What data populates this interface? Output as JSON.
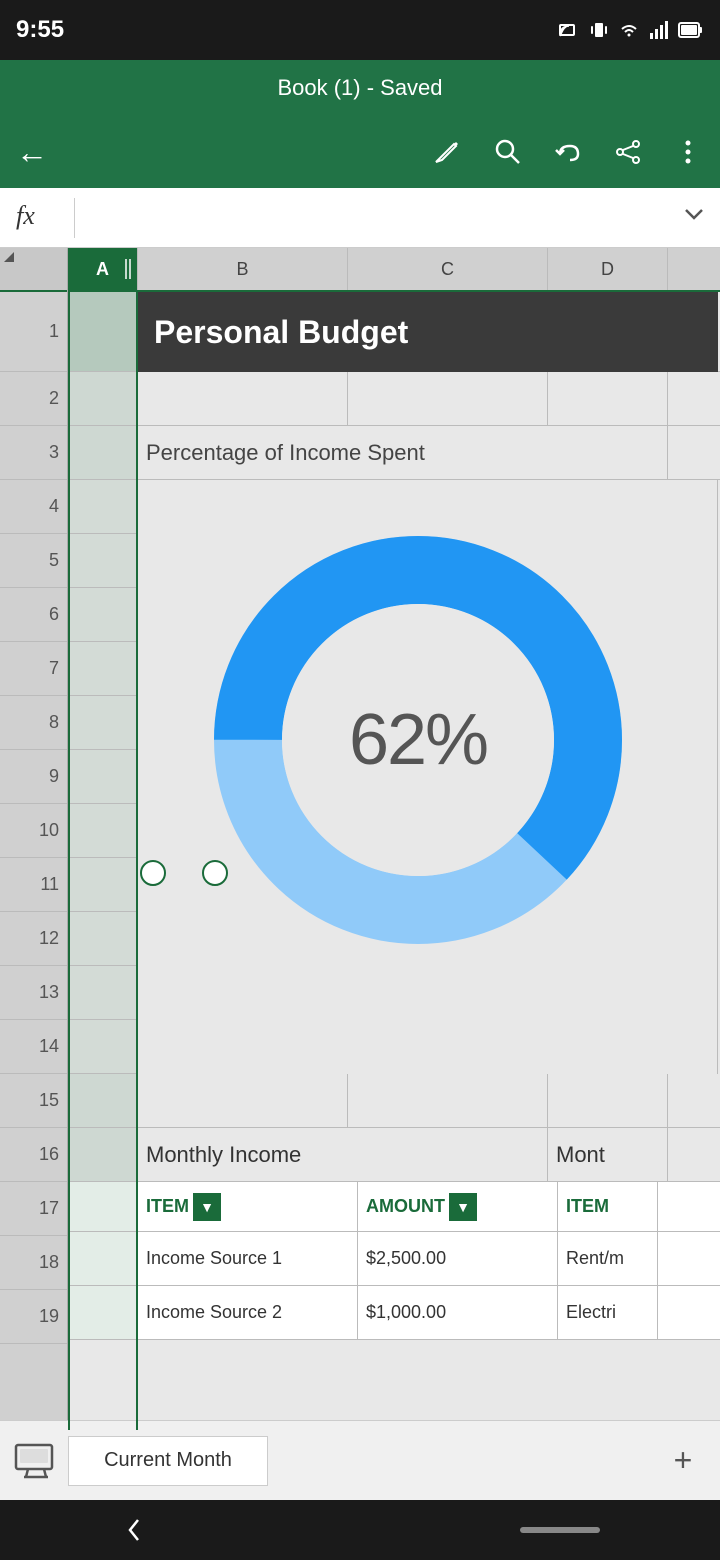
{
  "statusBar": {
    "time": "9:55",
    "icons": [
      "signal",
      "circle",
      "gmail",
      "calendar",
      "dot",
      "cast",
      "vibrate",
      "wifi",
      "signal-bars",
      "battery"
    ]
  },
  "titleBar": {
    "title": "Book (1) - Saved"
  },
  "toolbar": {
    "backLabel": "←",
    "editIcon": "✏",
    "searchIcon": "⌕",
    "undoIcon": "↩",
    "shareIcon": "⤴",
    "moreIcon": "⋮"
  },
  "formulaBar": {
    "fx": "fx",
    "expandIcon": "∨"
  },
  "spreadsheet": {
    "colHeaders": [
      "A",
      "B",
      "C",
      "D"
    ],
    "rowNumbers": [
      "",
      "1",
      "2",
      "3",
      "4",
      "5",
      "6",
      "7",
      "8",
      "9",
      "10",
      "11",
      "12",
      "13",
      "14",
      "15",
      "16",
      "17",
      "18",
      "19"
    ],
    "personalBudget": "Personal Budget",
    "percentageLabel": "Percentage of Income Spent",
    "donutPercent": "62%",
    "monthlyIncomeLabel": "Monthly Income",
    "monthlyExpenseLabel": "Mont",
    "itemHeader": "ITEM",
    "amountHeader": "AMOUNT",
    "expenseItemHeader": "ITEM",
    "incomeRow1Item": "Income Source 1",
    "incomeRow1Amount": "$2,500.00",
    "incomeRow2Item": "Income Source 2",
    "incomeRow2Amount": "$1,000.00",
    "expenseRow1Item": "Rent/m",
    "expenseRow2Item": "Electri",
    "donutMainColor": "#2196F3",
    "donutLightColor": "#90CAF9",
    "donutBg": "#e8e8e8"
  },
  "tabBar": {
    "sheetName": "Current Month",
    "addLabel": "+"
  },
  "navBar": {
    "backIcon": "‹",
    "homeBar": ""
  }
}
